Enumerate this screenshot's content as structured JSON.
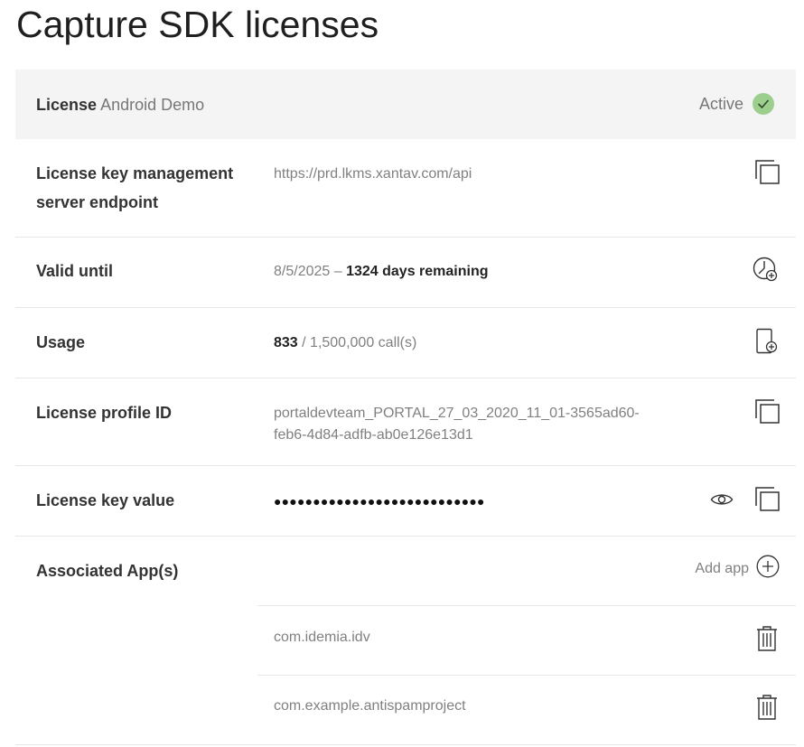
{
  "page": {
    "title": "Capture SDK licenses"
  },
  "license": {
    "label": "License",
    "name": "Android Demo",
    "status": "Active",
    "status_color": "#9ccf8e"
  },
  "rows": {
    "endpoint": {
      "label_line1": "License key management",
      "label_line2": "server endpoint",
      "value": "https://prd.lkms.xantav.com/api"
    },
    "valid_until": {
      "label": "Valid until",
      "date": "8/5/2025",
      "separator": " – ",
      "remaining": "1324 days remaining"
    },
    "usage": {
      "label": "Usage",
      "used": "833",
      "total": " / 1,500,000 call(s)"
    },
    "profile_id": {
      "label": "License profile ID",
      "value_line1": "portaldevteam_PORTAL_27_03_2020_11_01-3565ad60-",
      "value_line2": "feb6-4d84-adfb-ab0e126e13d1"
    },
    "key_value": {
      "label": "License key value",
      "masked": "●●●●●●●●●●●●●●●●●●●●●●●●●●●"
    },
    "apps": {
      "label": "Associated App(s)",
      "add_label": "Add app",
      "items": [
        "com.idemia.idv",
        "com.example.antispamproject"
      ]
    }
  },
  "icons": {
    "copy": "copy-icon",
    "clock_add": "clock-add-icon",
    "device_add": "device-add-icon",
    "eye": "eye-icon",
    "plus_circle": "plus-circle-icon",
    "trash": "trash-icon",
    "check": "check-icon"
  },
  "colors": {
    "header_bg": "#f4f4f4",
    "divider": "#e6e6e6",
    "active_green": "#9ccf8e"
  }
}
